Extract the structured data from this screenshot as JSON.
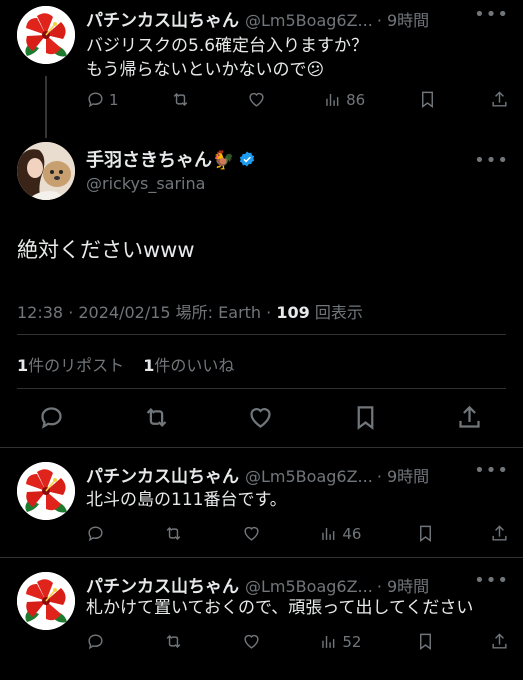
{
  "tweets": [
    {
      "name": "パチンカス山ちゃん",
      "handle": "@Lm5Boag6Z...",
      "time": "· 9時間",
      "lines": [
        "バジリスクの5.6確定台入りますか？",
        "もう帰らないといかないので😕"
      ],
      "replies": "1",
      "retweets": "",
      "likes": "",
      "views": "86"
    },
    {
      "name": "パチンカス山ちゃん",
      "handle": "@Lm5Boag6Z...",
      "time": "· 9時間",
      "lines": [
        "北斗の島の111番台です。"
      ],
      "replies": "",
      "retweets": "",
      "likes": "",
      "views": "46"
    },
    {
      "name": "パチンカス山ちゃん",
      "handle": "@Lm5Boag6Z...",
      "time": "· 9時間",
      "lines": [
        "札かけて置いておくので、頑張って出してください"
      ],
      "replies": "",
      "retweets": "",
      "likes": "",
      "views": "52"
    }
  ],
  "main": {
    "name": "手羽さきちゃん🐓",
    "handle": "@rickys_sarina",
    "text": "絶対くださいwww",
    "time": "12:38 · 2024/02/15 場所: Earth · ",
    "views_count": "109",
    "views_label": " 回表示",
    "reposts_count": "1",
    "reposts_label": "件のリポスト",
    "likes_count": "1",
    "likes_label": "件のいいね"
  },
  "more_glyph": "•••",
  "colors": {
    "background": "#000000",
    "text": "#e7e9ea",
    "muted": "#71767b",
    "verified": "#1d9bf0",
    "hibiscus": "#e0241b"
  }
}
